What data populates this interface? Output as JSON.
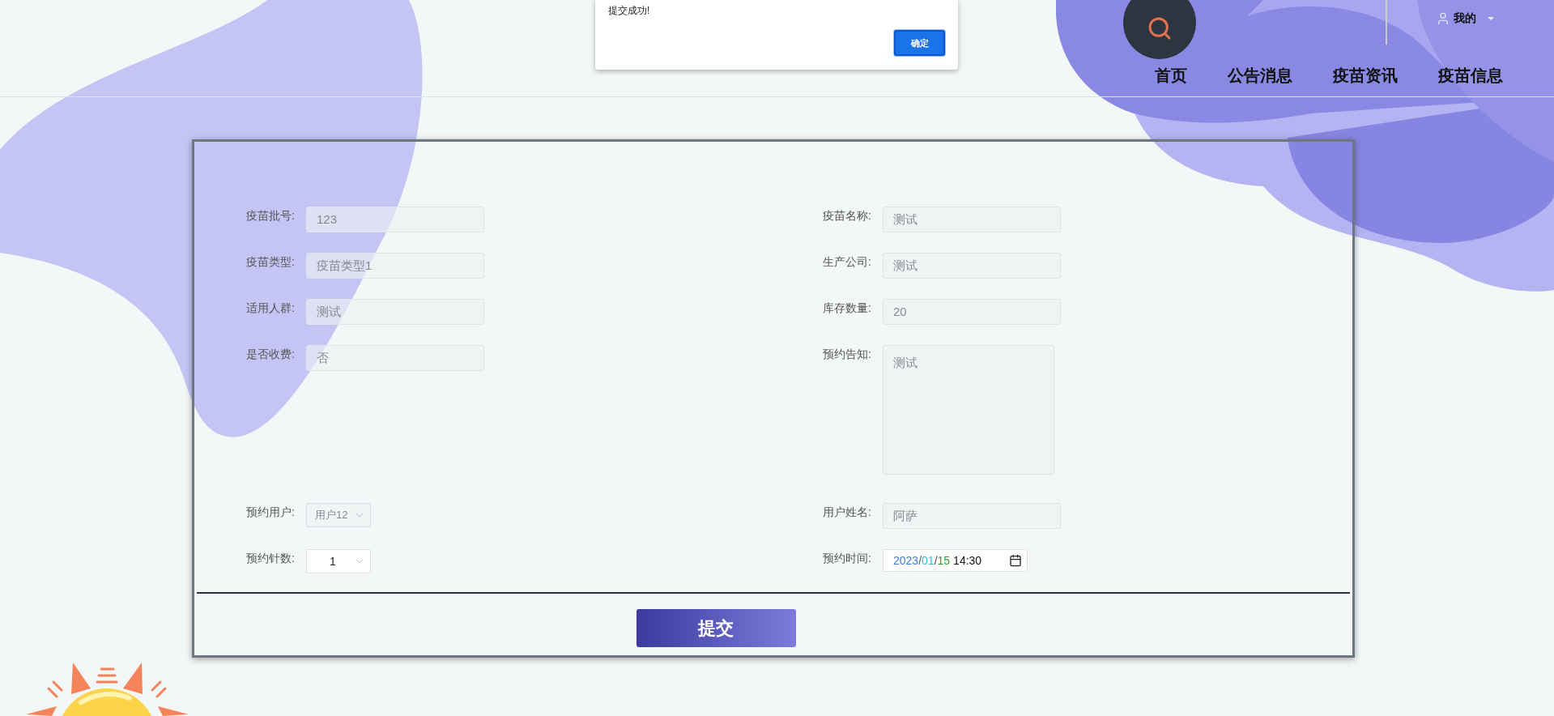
{
  "dialog": {
    "message": "提交成功!",
    "button": "确定"
  },
  "header": {
    "user": "我的",
    "nav": [
      {
        "label": "首页"
      },
      {
        "label": "公告消息"
      },
      {
        "label": "疫苗资讯"
      },
      {
        "label": "疫苗信息"
      }
    ]
  },
  "form": {
    "left": [
      {
        "label": "疫苗批号:",
        "kind": "input",
        "value": "123",
        "disabled": true
      },
      {
        "label": "疫苗类型:",
        "kind": "input",
        "value": "疫苗类型1",
        "disabled": true
      },
      {
        "label": "适用人群:",
        "kind": "input",
        "value": "测试",
        "disabled": true
      },
      {
        "label": "是否收费:",
        "kind": "input",
        "value": "否",
        "disabled": true
      },
      {
        "label": "预约用户:",
        "kind": "select",
        "value": "用户12",
        "disabled": true
      },
      {
        "label": "预约针数:",
        "kind": "select",
        "value": "1",
        "disabled": false
      }
    ],
    "right": [
      {
        "label": "疫苗名称:",
        "kind": "input",
        "value": "测试",
        "disabled": true
      },
      {
        "label": "生产公司:",
        "kind": "input",
        "value": "测试",
        "disabled": true
      },
      {
        "label": "库存数量:",
        "kind": "input",
        "value": "20",
        "disabled": true
      },
      {
        "label": "预约告知:",
        "kind": "textarea",
        "value": "测试",
        "disabled": true
      },
      {
        "label": "用户姓名:",
        "kind": "input",
        "value": "阿萨",
        "disabled": true
      },
      {
        "label": "预约时间:",
        "kind": "datetime",
        "disabled": false,
        "parts": [
          {
            "text": "2023",
            "color": "#3b7ddd"
          },
          {
            "text": "/",
            "color": "#555555"
          },
          {
            "text": "01",
            "color": "#36b9d9"
          },
          {
            "text": "/",
            "color": "#555555"
          },
          {
            "text": "15",
            "color": "#2ca02c"
          },
          {
            "text": "14:30",
            "color": "#111111"
          }
        ]
      }
    ],
    "submit": "提交"
  }
}
